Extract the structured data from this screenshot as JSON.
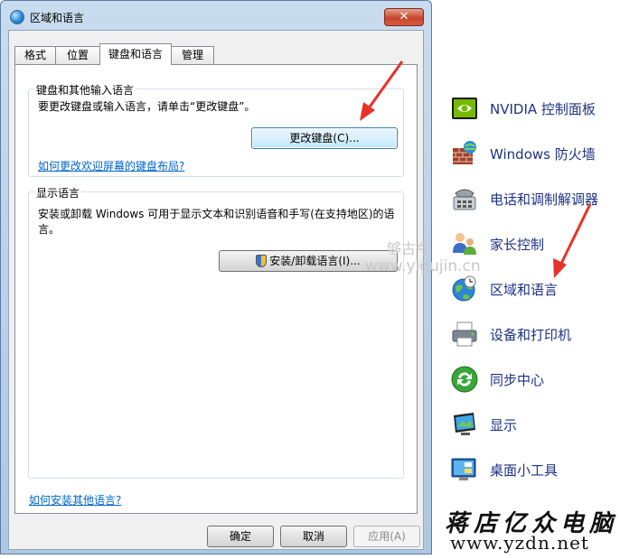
{
  "window": {
    "title": "区域和语言",
    "close_symbol": "✕"
  },
  "tabs": [
    {
      "label": "格式"
    },
    {
      "label": "位置"
    },
    {
      "label": "键盘和语言",
      "active": true
    },
    {
      "label": "管理"
    }
  ],
  "keyboard_group": {
    "label": "键盘和其他输入语言",
    "description": "要更改键盘或输入语言，请单击“更改键盘”。",
    "change_keyboard_button": "更改键盘(C)...",
    "link": "如何更改欢迎屏幕的键盘布局?"
  },
  "display_group": {
    "label": "显示语言",
    "description": "安装或卸载 Windows 可用于显示文本和识别语音和手写(在支持地区)的语言。",
    "install_button": "安装/卸载语言(I)..."
  },
  "footer": {
    "link": "如何安装其他语言?",
    "ok": "确定",
    "cancel": "取消",
    "apply": "应用(A)"
  },
  "control_panel_items": [
    {
      "label": "NVIDIA 控制面板",
      "icon": "nvidia-icon"
    },
    {
      "label": "Windows 防火墙",
      "icon": "firewall-icon"
    },
    {
      "label": "电话和调制解调器",
      "icon": "phone-modem-icon"
    },
    {
      "label": "家长控制",
      "icon": "parental-controls-icon"
    },
    {
      "label": "区域和语言",
      "icon": "globe-clock-icon"
    },
    {
      "label": "设备和打印机",
      "icon": "printer-icon"
    },
    {
      "label": "同步中心",
      "icon": "sync-icon"
    },
    {
      "label": "显示",
      "icon": "display-icon"
    },
    {
      "label": "桌面小工具",
      "icon": "gadgets-icon"
    }
  ],
  "watermark": {
    "name": "够古今",
    "url": "www.yigujin.cn"
  },
  "brand": {
    "title": "蒋店亿众电脑",
    "url": "www.yzdn.net"
  },
  "colors": {
    "link": "#0066cc",
    "cp_label": "#1e3287",
    "arrow": "#e8312a"
  }
}
